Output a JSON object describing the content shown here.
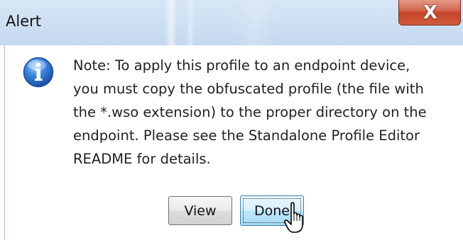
{
  "window": {
    "title": "Alert",
    "close_symbol": "X"
  },
  "icon": "info-icon",
  "message": {
    "lines": [
      "Note: To apply this profile to an endpoint device,",
      "you must copy the obfuscated profile (the file with",
      "the *.wso extension) to the proper directory on the",
      "endpoint.  Please  see the Standalone Profile Editor",
      "README for details."
    ]
  },
  "buttons": {
    "view_label": "View",
    "done_label": "Done"
  },
  "colors": {
    "titlebar": "#cfe0f3",
    "close_button": "#c4452a",
    "info_icon": "#2a6cc7",
    "default_button_border": "#3c7fb1"
  }
}
